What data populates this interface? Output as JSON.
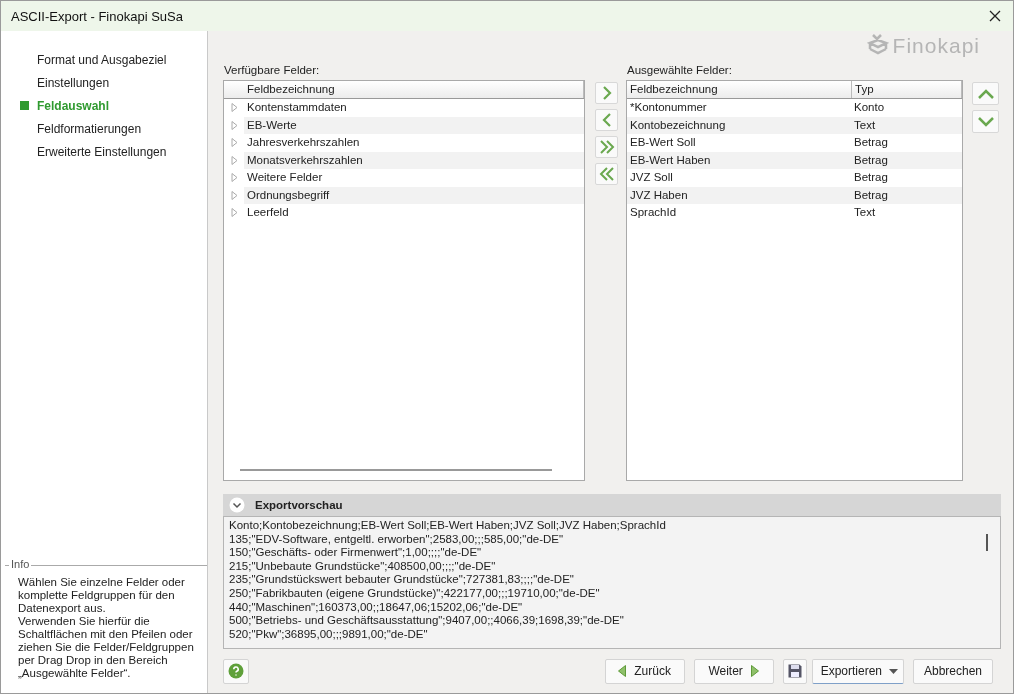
{
  "window": {
    "title": "ASCII-Export - Finokapi SuSa"
  },
  "steps": [
    {
      "label": "Format und Ausgabeziel",
      "selected": false
    },
    {
      "label": "Einstellungen",
      "selected": false
    },
    {
      "label": "Feldauswahl",
      "selected": true
    },
    {
      "label": "Feldformatierungen",
      "selected": false
    },
    {
      "label": "Erweiterte Einstellungen",
      "selected": false
    }
  ],
  "info": {
    "title": "Info",
    "text": "Wählen Sie einzelne Felder oder komplette Feldgruppen für den Datenexport aus.\nVerwenden Sie hierfür die Schaltflächen mit den Pfeilen oder ziehen Sie die Felder/Feldgruppen per Drag Drop in den Bereich „Ausgewählte Felder“."
  },
  "logo": "Finokapi",
  "available": {
    "label": "Verfügbare Felder:",
    "header": "Feldbezeichnung",
    "items": [
      {
        "label": "Kontenstammdaten",
        "expanded": false
      },
      {
        "label": "EB-Werte",
        "expanded": false
      },
      {
        "label": "Jahresverkehrszahlen",
        "expanded": false
      },
      {
        "label": "Monatsverkehrszahlen",
        "expanded": false
      },
      {
        "label": "Weitere Felder",
        "expanded": false
      },
      {
        "label": "Ordnungsbegriff",
        "expanded": false
      },
      {
        "label": "Leerfeld",
        "expanded": false
      }
    ]
  },
  "selected_fields": {
    "label": "Ausgewählte Felder:",
    "columns": [
      "Feldbezeichnung",
      "Typ"
    ],
    "rows": [
      [
        "*Kontonummer",
        "Konto"
      ],
      [
        "Kontobezeichnung",
        "Text"
      ],
      [
        "EB-Wert Soll",
        "Betrag"
      ],
      [
        "EB-Wert Haben",
        "Betrag"
      ],
      [
        "JVZ Soll",
        "Betrag"
      ],
      [
        "JVZ Haben",
        "Betrag"
      ],
      [
        "SprachId",
        "Text"
      ]
    ]
  },
  "preview": {
    "title": "Exportvorschau",
    "expanded": true,
    "lines": [
      "Konto;Kontobezeichnung;EB-Wert Soll;EB-Wert Haben;JVZ Soll;JVZ Haben;SprachId",
      "135;\"EDV-Software, entgeltl. erworben\";2583,00;;;585,00;\"de-DE\"",
      "150;\"Geschäfts- oder Firmenwert\";1,00;;;;\"de-DE\"",
      "215;\"Unbebaute Grundstücke\";408500,00;;;;\"de-DE\"",
      "235;\"Grundstückswert bebauter Grundstücke\";727381,83;;;;\"de-DE\"",
      "250;\"Fabrikbauten (eigene Grundstücke)\";422177,00;;;19710,00;\"de-DE\"",
      "440;\"Maschinen\";160373,00;;18647,06;15202,06;\"de-DE\"",
      "500;\"Betriebs- und Geschäftsausstattung\";9407,00;;4066,39;1698,39;\"de-DE\"",
      "520;\"Pkw\";36895,00;;;9891,00;\"de-DE\""
    ]
  },
  "footer": {
    "buttons": [
      {
        "label": "Zurück",
        "kind": "back"
      },
      {
        "label": "Weiter",
        "kind": "next"
      },
      {
        "kind": "save"
      },
      {
        "label": "Exportieren",
        "kind": "dropdown"
      },
      {
        "label": "Abbrechen",
        "kind": "plain"
      }
    ]
  }
}
